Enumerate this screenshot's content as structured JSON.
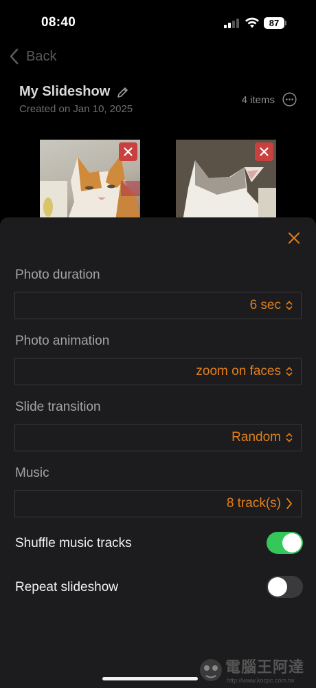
{
  "status_bar": {
    "time": "08:40",
    "battery": "87"
  },
  "nav": {
    "back_label": "Back"
  },
  "album": {
    "title": "My Slideshow",
    "created": "Created on Jan 10, 2025",
    "item_count": "4 items"
  },
  "settings": {
    "photo_duration": {
      "label": "Photo duration",
      "value": "6 sec"
    },
    "photo_animation": {
      "label": "Photo animation",
      "value": "zoom on faces"
    },
    "slide_transition": {
      "label": "Slide transition",
      "value": "Random"
    },
    "music": {
      "label": "Music",
      "value": "8 track(s)"
    },
    "shuffle": {
      "label": "Shuffle music tracks",
      "on": true
    },
    "repeat": {
      "label": "Repeat slideshow",
      "on": false
    }
  },
  "watermark": {
    "title": "電腦王阿達",
    "url": "http://www.kocpc.com.tw"
  },
  "colors": {
    "accent": "#e2801c",
    "toggle_on": "#34c759",
    "remove": "#c9403e",
    "sheet_bg": "#1c1c1e"
  }
}
